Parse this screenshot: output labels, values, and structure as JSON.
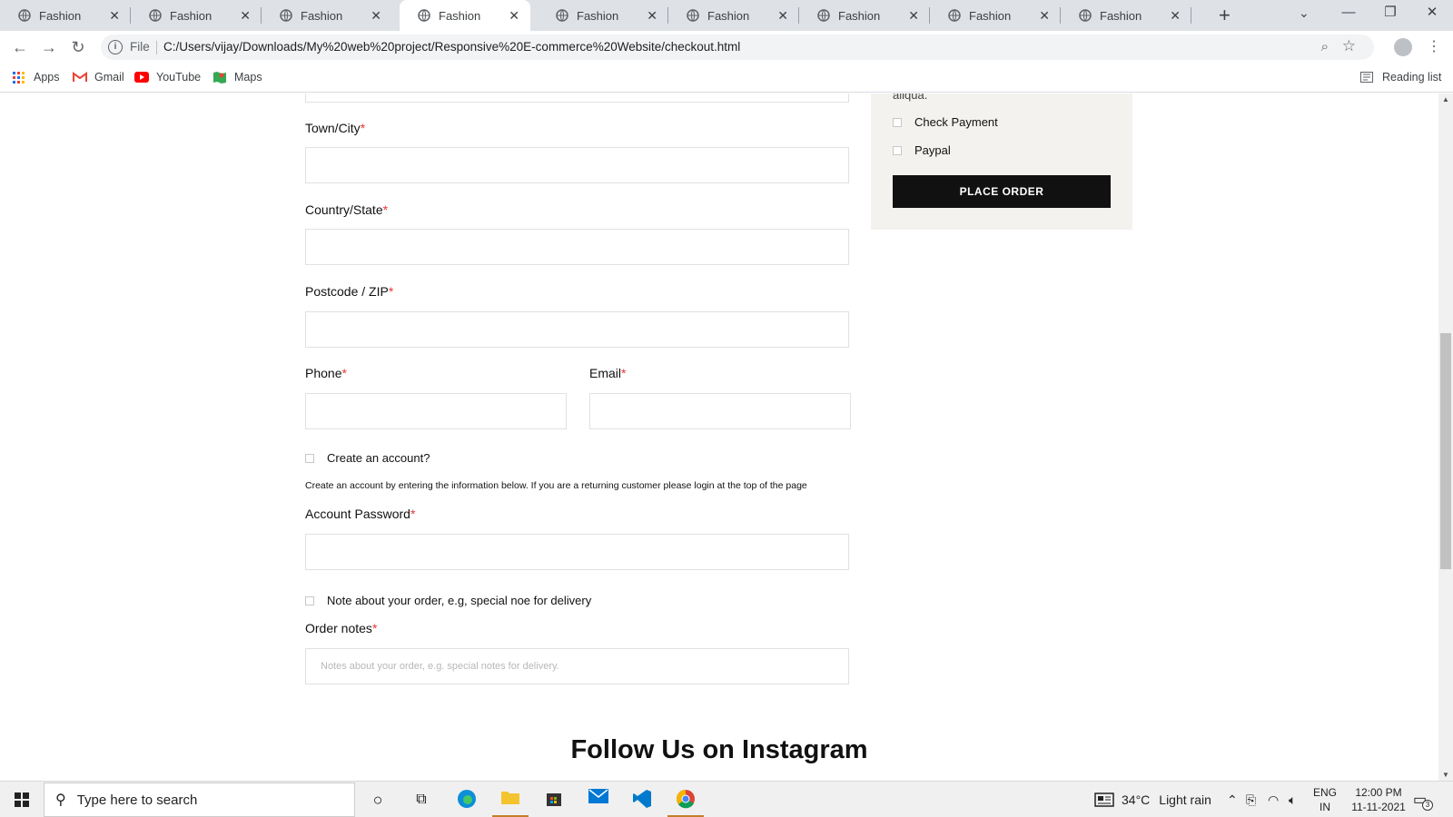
{
  "browser": {
    "tabs": [
      {
        "title": "Fashion"
      },
      {
        "title": "Fashion"
      },
      {
        "title": "Fashion"
      },
      {
        "title": "Fashion"
      },
      {
        "title": "Fashion"
      },
      {
        "title": "Fashion"
      },
      {
        "title": "Fashion"
      },
      {
        "title": "Fashion"
      },
      {
        "title": "Fashion"
      }
    ],
    "active_tab_index": 3,
    "address": {
      "scheme_label": "File",
      "url": "C:/Users/vijay/Downloads/My%20web%20project/Responsive%20E-commerce%20Website/checkout.html"
    },
    "bookmarks": [
      {
        "label": "Apps"
      },
      {
        "label": "Gmail"
      },
      {
        "label": "YouTube"
      },
      {
        "label": "Maps"
      }
    ],
    "reading_list": "Reading list"
  },
  "checkout": {
    "required_mark": "*",
    "town_label": "Town/City",
    "country_label": "Country/State",
    "postcode_label": "Postcode / ZIP",
    "phone_label": "Phone",
    "email_label": "Email",
    "create_account_label": "Create an account?",
    "create_account_help": "Create an account by entering the information below. If you are a returning customer please login at the top of the page",
    "password_label": "Account Password",
    "note_check_label": "Note about your order, e.g, special noe for delivery",
    "order_notes_label": "Order notes",
    "order_notes_placeholder": "Notes about your order, e.g. special notes for delivery."
  },
  "order_summary": {
    "partial_text": "aliqua.",
    "payment_options": [
      {
        "label": "Check Payment"
      },
      {
        "label": "Paypal"
      }
    ],
    "place_order_label": "PLACE ORDER"
  },
  "instagram": {
    "title": "Follow Us on Instagram"
  },
  "taskbar": {
    "search_placeholder": "Type here to search",
    "weather": "34°C",
    "weather_desc": "Light rain",
    "lang_1": "ENG",
    "lang_2": "IN",
    "time": "12:00 PM",
    "date": "11-11-2021",
    "notification_count": "3"
  }
}
